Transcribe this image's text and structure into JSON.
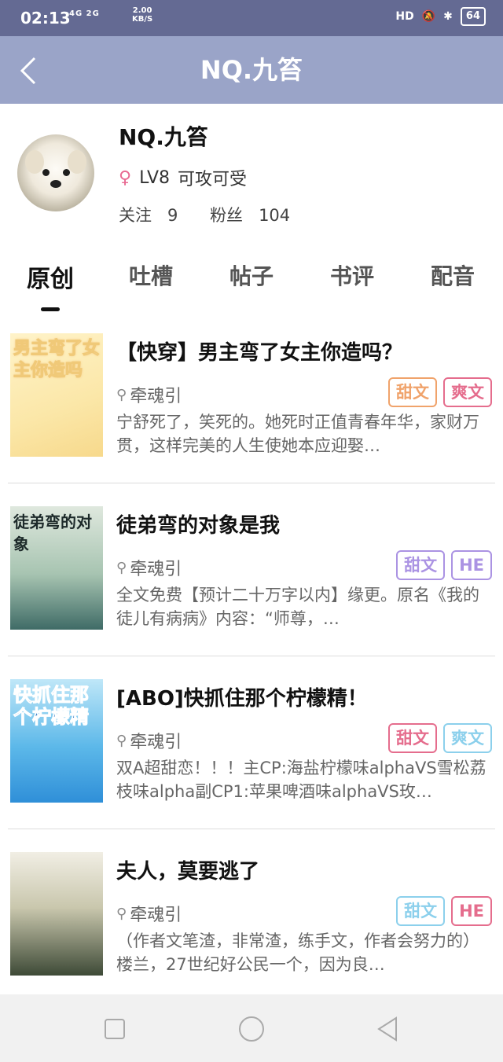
{
  "status_bar": {
    "time": "02:13",
    "network": "4G 2G",
    "speed_value": "2.00",
    "speed_unit": "KB/S",
    "hd_label": "HD",
    "battery": "64"
  },
  "app_bar": {
    "title": "NQ.九笞"
  },
  "profile": {
    "name": "NQ.九笞",
    "level": "LV8",
    "bio": "可攻可受",
    "follow_label": "关注",
    "follow_count": "9",
    "fans_label": "粉丝",
    "fans_count": "104"
  },
  "tabs": [
    "原创",
    "吐槽",
    "帖子",
    "书评",
    "配音"
  ],
  "colors": {
    "status_bar": "#646a93",
    "app_bar": "#9aa4c8",
    "tag_orange": "#f0a36b",
    "tag_pink": "#e56d8d",
    "tag_purple": "#ab93e3",
    "tag_blue": "#8cd0ec"
  },
  "books": [
    {
      "title": "【快穿】男主弯了女主你造吗？",
      "author": "牵魂引",
      "tags": [
        {
          "label": "甜文",
          "color": "#f0a36b"
        },
        {
          "label": "爽文",
          "color": "#e56d8d"
        }
      ],
      "desc": "宁舒死了，笑死的。她死时正值青春年华，家财万贯，这样完美的人生使她本应迎娶…",
      "cover_text": "男主弯了女主你造吗"
    },
    {
      "title": "徒弟弯的对象是我",
      "author": "牵魂引",
      "tags": [
        {
          "label": "甜文",
          "color": "#ab93e3"
        },
        {
          "label": "HE",
          "color": "#ab93e3"
        }
      ],
      "desc": "全文免费【预计二十万字以内】缘更。原名《我的徒儿有病病》内容：“师尊，…",
      "cover_text": "徒弟弯的对象"
    },
    {
      "title": "[ABO]快抓住那个柠檬精！",
      "author": "牵魂引",
      "tags": [
        {
          "label": "甜文",
          "color": "#e56d8d"
        },
        {
          "label": "爽文",
          "color": "#8cd0ec"
        }
      ],
      "desc": "双A超甜恋！！！主CP:海盐柠檬味alphaVS雪松荔枝味alpha副CP1:苹果啤酒味alphaVS玫…",
      "cover_text": "快抓住那个柠檬精"
    },
    {
      "title": "夫人，莫要逃了",
      "author": "牵魂引",
      "tags": [
        {
          "label": "甜文",
          "color": "#8cd0ec"
        },
        {
          "label": "HE",
          "color": "#e56d8d"
        }
      ],
      "desc": "（作者文笔渣，非常渣，练手文，作者会努力的）楼兰，27世纪好公民一个，因为良…",
      "cover_text": ""
    }
  ]
}
